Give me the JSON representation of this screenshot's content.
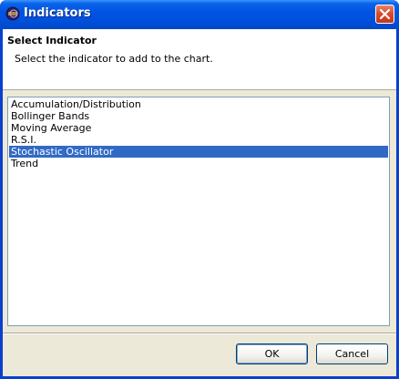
{
  "window": {
    "title": "Indicators",
    "icon": "eclipse-app-icon",
    "close_icon": "close-icon"
  },
  "header": {
    "title": "Select Indicator",
    "message": "Select the indicator to add to the chart."
  },
  "indicator_list": {
    "items": [
      {
        "label": "Accumulation/Distribution",
        "selected": false
      },
      {
        "label": "Bollinger Bands",
        "selected": false
      },
      {
        "label": "Moving Average",
        "selected": false
      },
      {
        "label": "R.S.I.",
        "selected": false
      },
      {
        "label": "Stochastic Oscillator",
        "selected": true
      },
      {
        "label": "Trend",
        "selected": false
      }
    ]
  },
  "buttons": {
    "ok_label": "OK",
    "cancel_label": "Cancel"
  },
  "colors": {
    "title_bar": "#0054e3",
    "selection": "#316ac5",
    "dialog_bg": "#ece9d8",
    "close_button": "#d9482b"
  }
}
